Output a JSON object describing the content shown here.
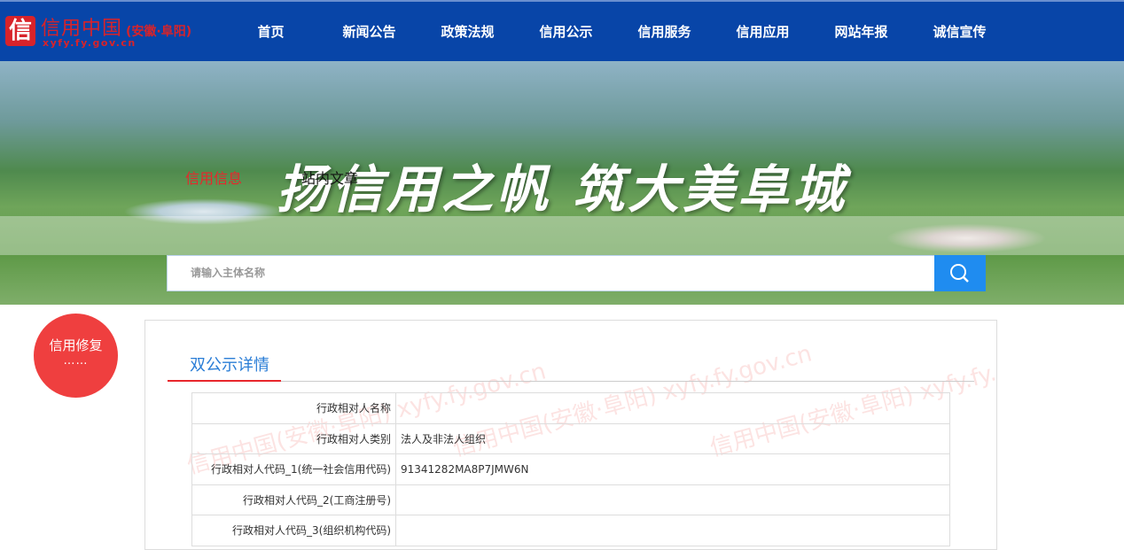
{
  "header": {
    "logo_char": "信",
    "logo_title": "信用中国",
    "logo_region": "(安徽·阜阳)",
    "logo_url": "xyfy.fy.gov.cn",
    "nav": [
      "首页",
      "新闻公告",
      "政策法规",
      "信用公示",
      "信用服务",
      "信用应用",
      "网站年报",
      "诚信宣传"
    ]
  },
  "banner": {
    "slogan": "扬信用之帆  筑大美阜城"
  },
  "search": {
    "tabs": [
      "信用信息",
      "站内文章"
    ],
    "placeholder": "请输入主体名称"
  },
  "repair": {
    "label": "信用修复",
    "dots": "……"
  },
  "panel": {
    "title": "双公示详情",
    "watermark": "信用中国(安徽·阜阳) xyfy.fy.gov.cn",
    "rows": [
      {
        "k": "行政相对人名称",
        "v": ""
      },
      {
        "k": "行政相对人类别",
        "v": "法人及非法人组织"
      },
      {
        "k": "行政相对人代码_1(统一社会信用代码)",
        "v": "91341282MA8P7JMW6N"
      },
      {
        "k": "行政相对人代码_2(工商注册号)",
        "v": ""
      },
      {
        "k": "行政相对人代码_3(组织机构代码)",
        "v": ""
      }
    ]
  }
}
